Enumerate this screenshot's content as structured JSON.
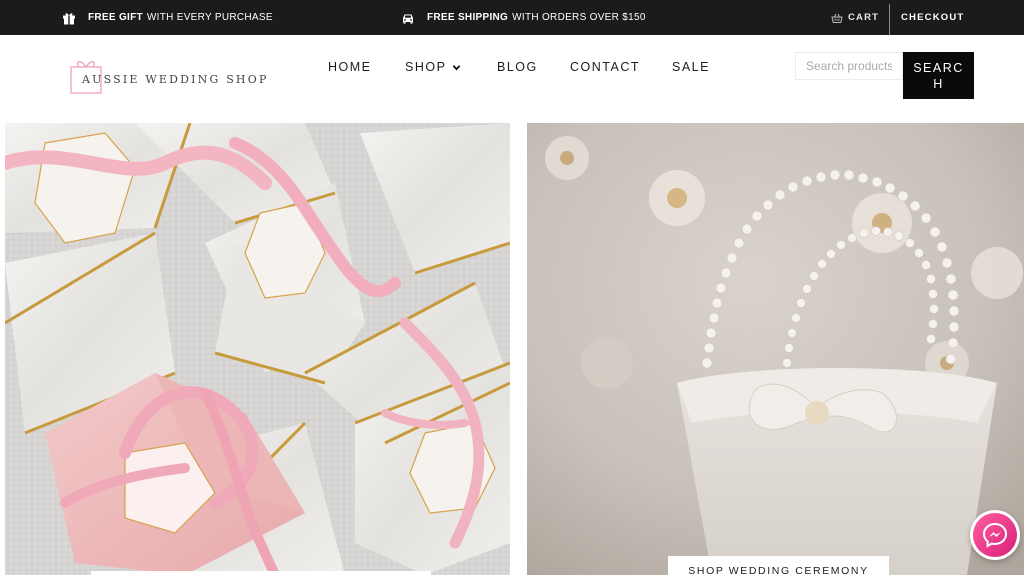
{
  "topbar": {
    "gift_bold": "FREE GIFT",
    "gift_text": "WITH EVERY PURCHASE",
    "gift_icon": "gift-icon",
    "ship_bold": "FREE SHIPPING",
    "ship_text": "WITH ORDERS OVER $150",
    "ship_icon": "car-icon",
    "cart_label": "CART",
    "cart_icon": "basket-icon",
    "checkout_label": "CHECKOUT"
  },
  "header": {
    "logo_text": "AUSSIE WEDDING SHOP",
    "nav": {
      "home": "HOME",
      "shop": "SHOP",
      "blog": "BLOG",
      "contact": "CONTACT",
      "sale": "SALE"
    },
    "search_placeholder": "Search products…",
    "search_button": "SEARCH"
  },
  "hero": {
    "right_cta": "SHOP WEDDING CEREMONY"
  },
  "colors": {
    "topbar_bg": "#1b1b1b",
    "accent_pink": "#f2b8c6",
    "gold": "#c79a3c",
    "messenger": "#e0287f"
  }
}
